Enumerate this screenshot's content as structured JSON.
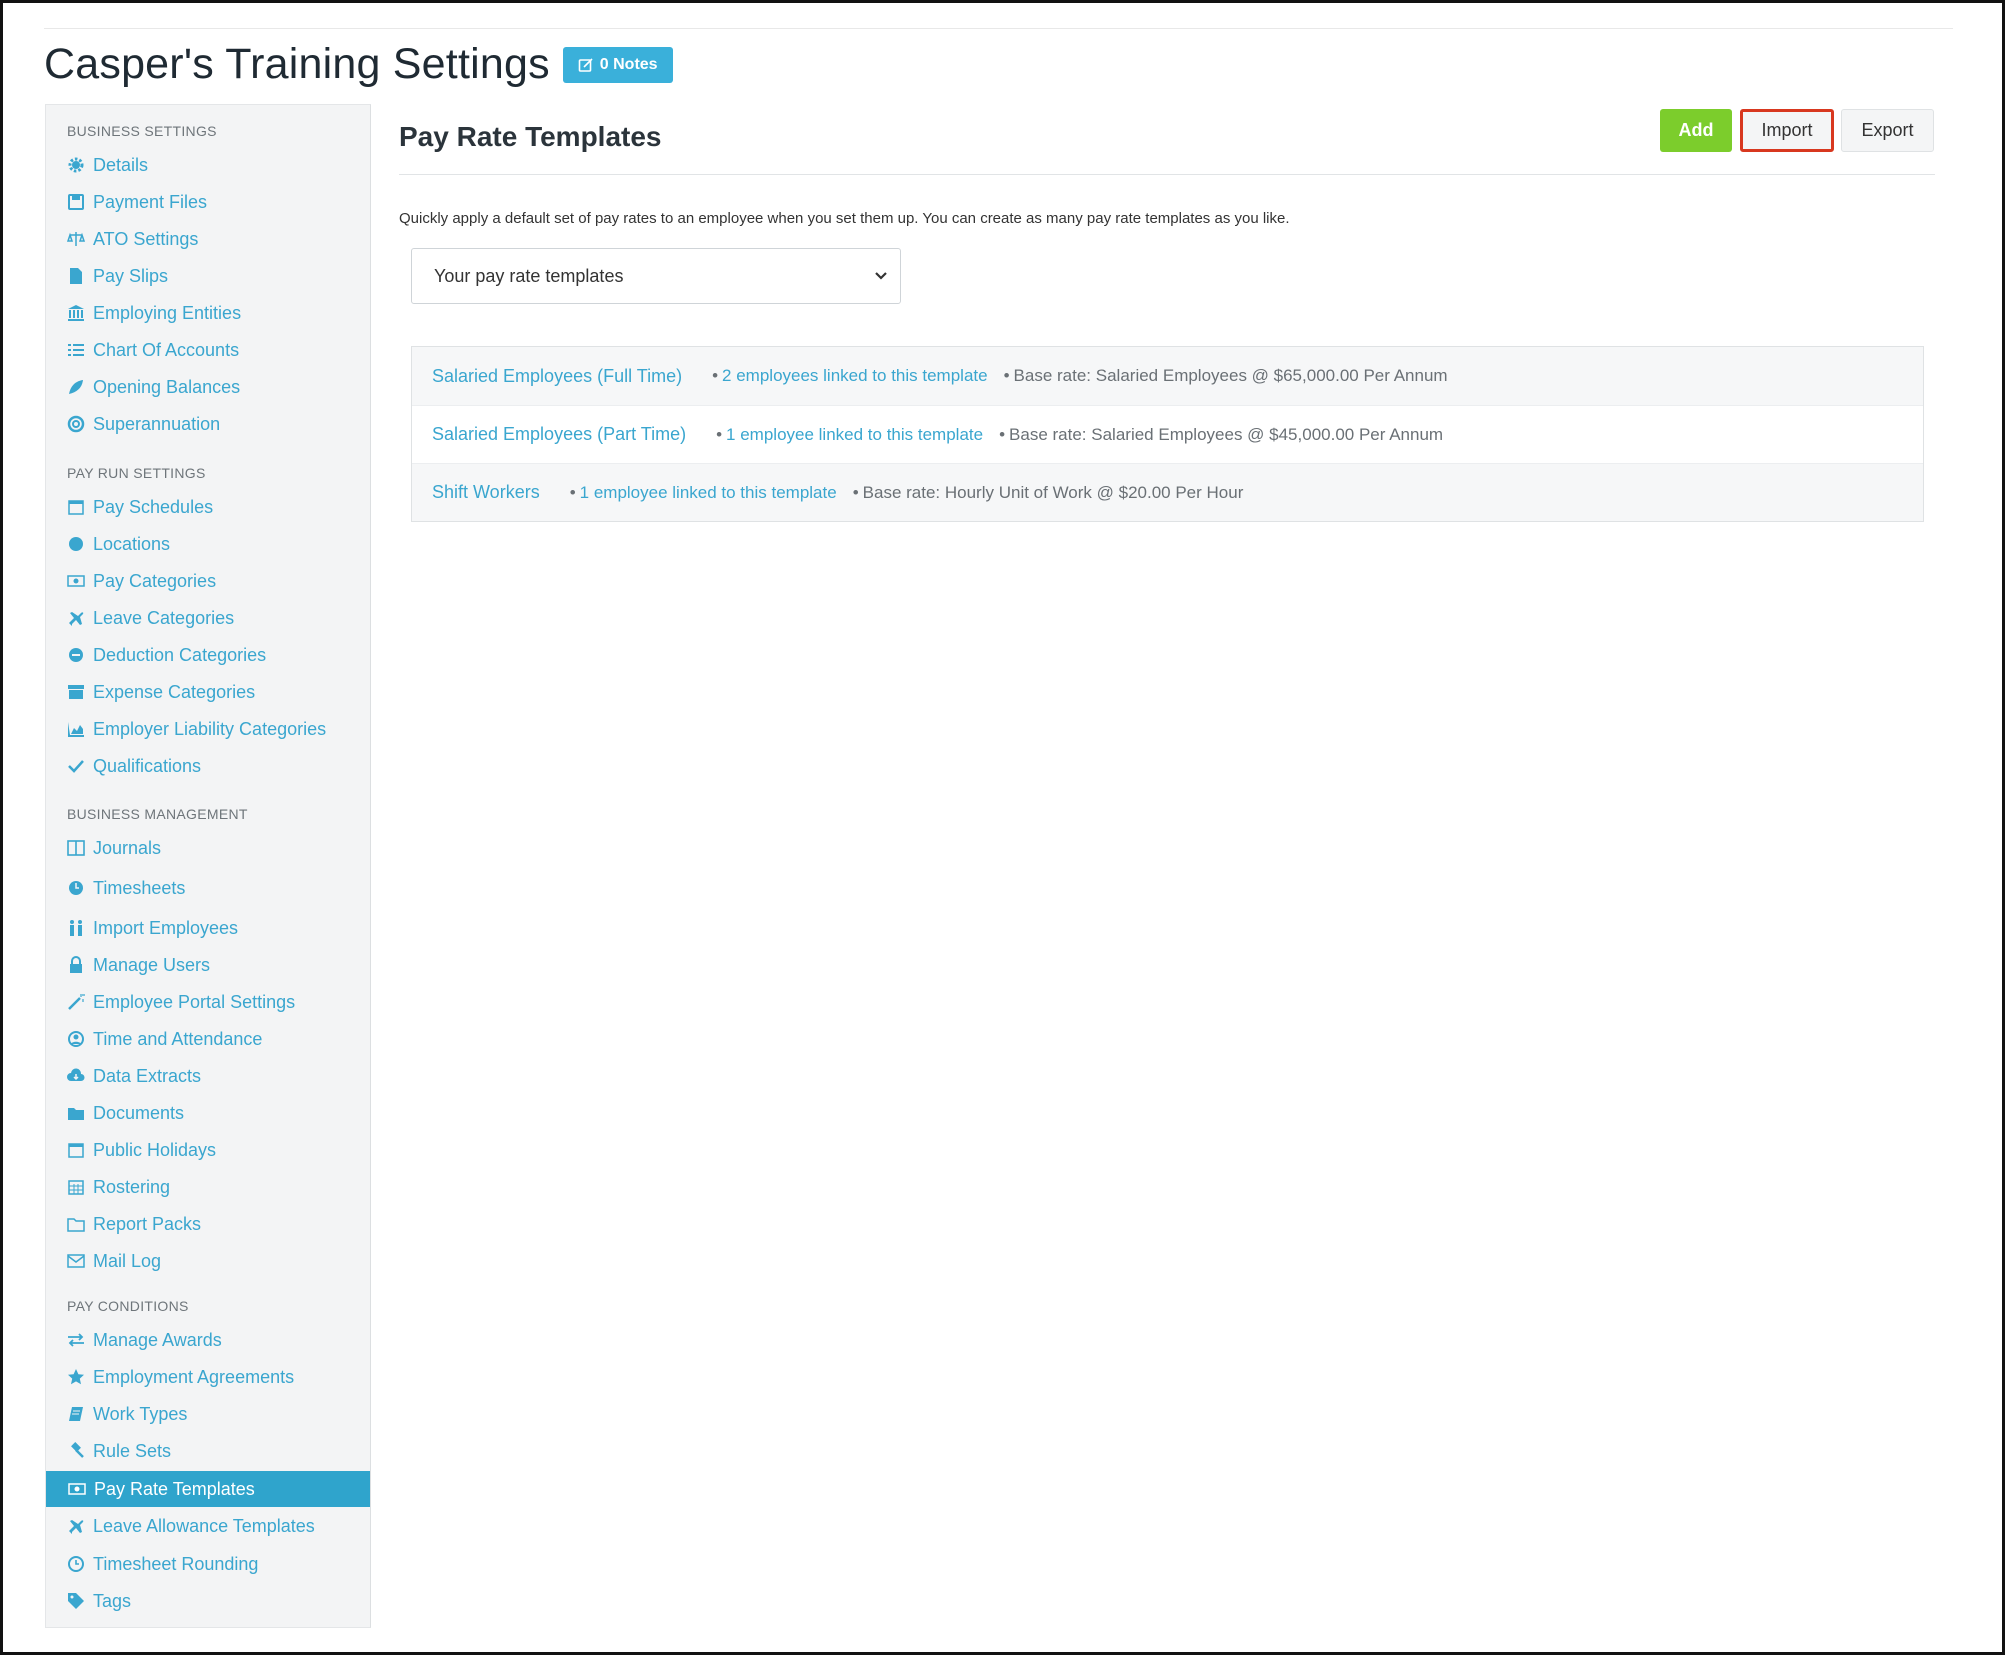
{
  "header": {
    "title": "Casper's Training Settings",
    "notes_label": "0 Notes"
  },
  "sidebar": {
    "sections": [
      {
        "title": "BUSINESS SETTINGS",
        "items": [
          {
            "label": "Details",
            "icon": "gear-icon"
          },
          {
            "label": "Payment Files",
            "icon": "save-icon"
          },
          {
            "label": "ATO Settings",
            "icon": "scale-icon"
          },
          {
            "label": "Pay Slips",
            "icon": "file-icon"
          },
          {
            "label": "Employing Entities",
            "icon": "bank-icon"
          },
          {
            "label": "Chart Of Accounts",
            "icon": "list-icon"
          },
          {
            "label": "Opening Balances",
            "icon": "leaf-icon"
          },
          {
            "label": "Superannuation",
            "icon": "lifebuoy-icon"
          }
        ]
      },
      {
        "title": "PAY RUN SETTINGS",
        "items": [
          {
            "label": "Pay Schedules",
            "icon": "calendar-icon"
          },
          {
            "label": "Locations",
            "icon": "globe-icon"
          },
          {
            "label": "Pay Categories",
            "icon": "money-icon"
          },
          {
            "label": "Leave Categories",
            "icon": "plane-icon"
          },
          {
            "label": "Deduction Categories",
            "icon": "minus-circle-icon"
          },
          {
            "label": "Expense Categories",
            "icon": "archive-icon"
          },
          {
            "label": "Employer Liability Categories",
            "icon": "area-chart-icon"
          },
          {
            "label": "Qualifications",
            "icon": "check-icon"
          }
        ]
      },
      {
        "title": "BUSINESS MANAGEMENT",
        "items": [
          {
            "label": "Journals",
            "icon": "columns-icon"
          },
          {
            "label": "Timesheets",
            "icon": "clock-icon"
          },
          {
            "label": "Import Employees",
            "icon": "people-icon"
          },
          {
            "label": "Manage Users",
            "icon": "lock-icon"
          },
          {
            "label": "Employee Portal Settings",
            "icon": "magic-wand-icon"
          },
          {
            "label": "Time and Attendance",
            "icon": "user-circle-icon"
          },
          {
            "label": "Data Extracts",
            "icon": "cloud-download-icon"
          },
          {
            "label": "Documents",
            "icon": "folder-icon"
          },
          {
            "label": "Public Holidays",
            "icon": "calendar-icon"
          },
          {
            "label": "Rostering",
            "icon": "calendar-grid-icon"
          },
          {
            "label": "Report Packs",
            "icon": "folder-open-icon"
          },
          {
            "label": "Mail Log",
            "icon": "envelope-icon"
          }
        ]
      },
      {
        "title": "PAY CONDITIONS",
        "items": [
          {
            "label": "Manage Awards",
            "icon": "exchange-icon"
          },
          {
            "label": "Employment Agreements",
            "icon": "star-icon"
          },
          {
            "label": "Work Types",
            "icon": "book-icon"
          },
          {
            "label": "Rule Sets",
            "icon": "gavel-icon"
          },
          {
            "label": "Pay Rate Templates",
            "icon": "money-icon",
            "active": true
          },
          {
            "label": "Leave Allowance Templates",
            "icon": "plane-icon"
          },
          {
            "label": "Timesheet Rounding",
            "icon": "clock-outline-icon"
          },
          {
            "label": "Tags",
            "icon": "tag-icon"
          }
        ]
      }
    ]
  },
  "main": {
    "title": "Pay Rate Templates",
    "buttons": {
      "add": "Add",
      "import": "Import",
      "export": "Export"
    },
    "description": "Quickly apply a default set of pay rates to an employee when you set them up. You can create as many pay rate templates as you like.",
    "select_value": "Your pay rate templates",
    "templates": [
      {
        "name": "Salaried Employees (Full Time)",
        "linked": "2 employees linked to this template",
        "base": "Base rate: Salaried Employees @ $65,000.00 Per Annum"
      },
      {
        "name": "Salaried Employees (Part Time)",
        "linked": "1 employee linked to this template",
        "base": "Base rate: Salaried Employees @ $45,000.00 Per Annum"
      },
      {
        "name": "Shift Workers",
        "linked": "1 employee linked to this template",
        "base": "Base rate: Hourly Unit of Work @ $20.00 Per Hour"
      }
    ]
  },
  "colors": {
    "accent": "#3aa6cf",
    "add": "#7ccd2c",
    "active": "#2fa4cc",
    "highlight": "#d8381f"
  }
}
